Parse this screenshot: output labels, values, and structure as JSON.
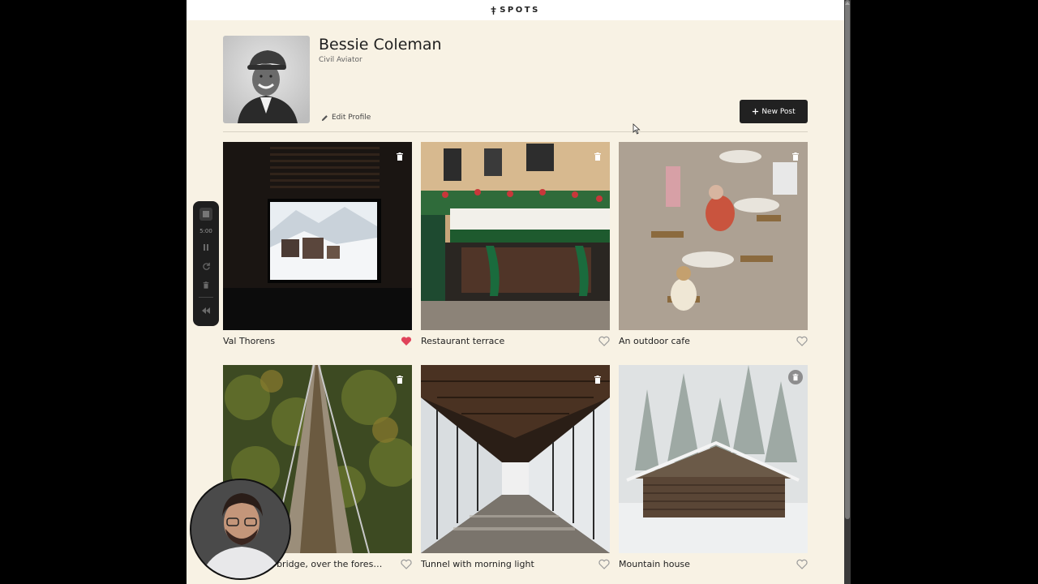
{
  "app": {
    "brand": "SPOTS"
  },
  "profile": {
    "name": "Bessie Coleman",
    "description": "Civil Aviator",
    "edit_label": "Edit Profile",
    "new_post_label": "New Post"
  },
  "cards": [
    {
      "title": "Val Thorens",
      "liked": true,
      "delete_style": "plain"
    },
    {
      "title": "Restaurant terrace",
      "liked": false,
      "delete_style": "plain"
    },
    {
      "title": "An outdoor cafe",
      "liked": false,
      "delete_style": "plain"
    },
    {
      "title": "A very long bridge, over the forest...",
      "liked": false,
      "delete_style": "plain"
    },
    {
      "title": "Tunnel with morning light",
      "liked": false,
      "delete_style": "plain"
    },
    {
      "title": "Mountain house",
      "liked": false,
      "delete_style": "round"
    }
  ],
  "recorder": {
    "time": "5:00"
  },
  "colors": {
    "liked": "#e0435a",
    "unliked": "#9a9a9a",
    "page_bg": "#f8f2e4",
    "button_bg": "#212121"
  }
}
